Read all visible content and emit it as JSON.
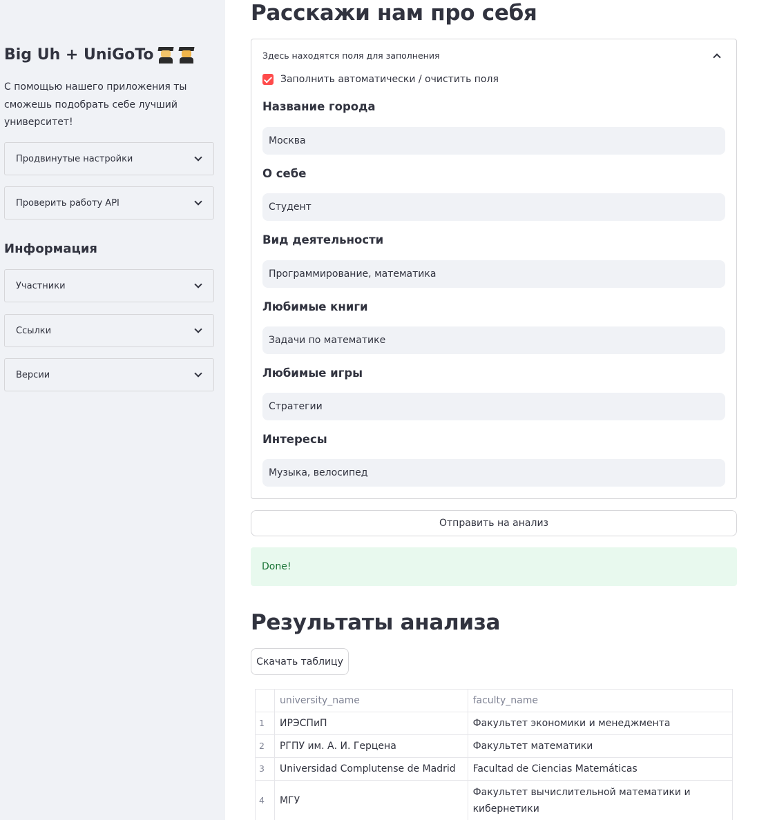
{
  "sidebar": {
    "title": "Big Uh + UniGoTo",
    "title_icons": [
      "man-student-icon",
      "man-student-icon"
    ],
    "description": "С помощью нашего приложения ты сможешь подобрать себе лучший университет!",
    "expanders": [
      {
        "label": "Продвинутые настройки"
      },
      {
        "label": "Проверить работу API"
      }
    ],
    "info_heading": "Информация",
    "info_expanders": [
      {
        "label": "Участники"
      },
      {
        "label": "Ссылки"
      },
      {
        "label": "Версии"
      }
    ]
  },
  "main": {
    "title": "Расскажи нам про себя",
    "form": {
      "expander_label": "Здесь находятся поля для заполнения",
      "autofill_checkbox": {
        "label": "Заполнить автоматически / очистить поля",
        "checked": true
      },
      "fields": [
        {
          "label": "Название города",
          "value": "Москва"
        },
        {
          "label": "О себе",
          "value": "Студент"
        },
        {
          "label": "Вид деятельности",
          "value": "Программирование, математика"
        },
        {
          "label": "Любимые книги",
          "value": "Задачи по математике"
        },
        {
          "label": "Любимые игры",
          "value": "Стратегии"
        },
        {
          "label": "Интересы",
          "value": "Музыка, велосипед"
        }
      ]
    },
    "submit_label": "Отправить на анализ",
    "status": "Done!",
    "results_title": "Результаты анализа",
    "download_label": "Скачать таблицу",
    "table": {
      "columns": [
        "",
        "university_name",
        "faculty_name"
      ],
      "rows": [
        {
          "index": "1",
          "university_name": "ИРЭСПиП",
          "faculty_name": "Факультет экономики и менеджмента"
        },
        {
          "index": "2",
          "university_name": "РГПУ им. А. И. Герцена",
          "faculty_name": "Факультет математики"
        },
        {
          "index": "3",
          "university_name": "Universidad Complutense de Madrid",
          "faculty_name": "Facultad de Ciencias Matemáticas"
        },
        {
          "index": "4",
          "university_name": "МГУ",
          "faculty_name": "Факультет вычислительной математики и кибернетики"
        }
      ]
    }
  },
  "colors": {
    "sidebar_bg": "#f0f2f6",
    "accent": "#ff4b4b",
    "success_bg": "#e8f9ee",
    "success_text": "#177233"
  }
}
